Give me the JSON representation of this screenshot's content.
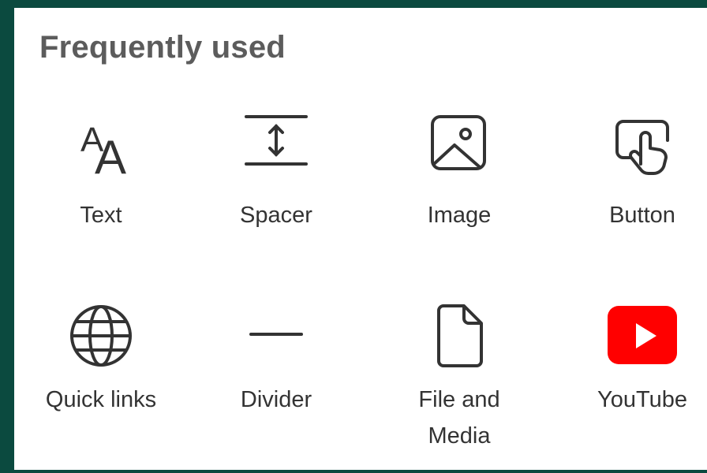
{
  "section": {
    "title": "Frequently used"
  },
  "tiles": [
    {
      "label": "Text",
      "icon": "text-icon"
    },
    {
      "label": "Spacer",
      "icon": "spacer-icon"
    },
    {
      "label": "Image",
      "icon": "image-icon"
    },
    {
      "label": "Button",
      "icon": "button-tap-icon"
    },
    {
      "label": "Quick links",
      "icon": "globe-icon"
    },
    {
      "label": "Divider",
      "icon": "divider-icon"
    },
    {
      "label": "File and\nMedia",
      "icon": "file-icon"
    },
    {
      "label": "YouTube",
      "icon": "youtube-icon"
    }
  ],
  "colors": {
    "background": "#0b4a3f",
    "panel": "#ffffff",
    "title": "#5c5c5c",
    "label": "#333333",
    "icon_stroke": "#333333",
    "youtube_red": "#ff0000"
  }
}
